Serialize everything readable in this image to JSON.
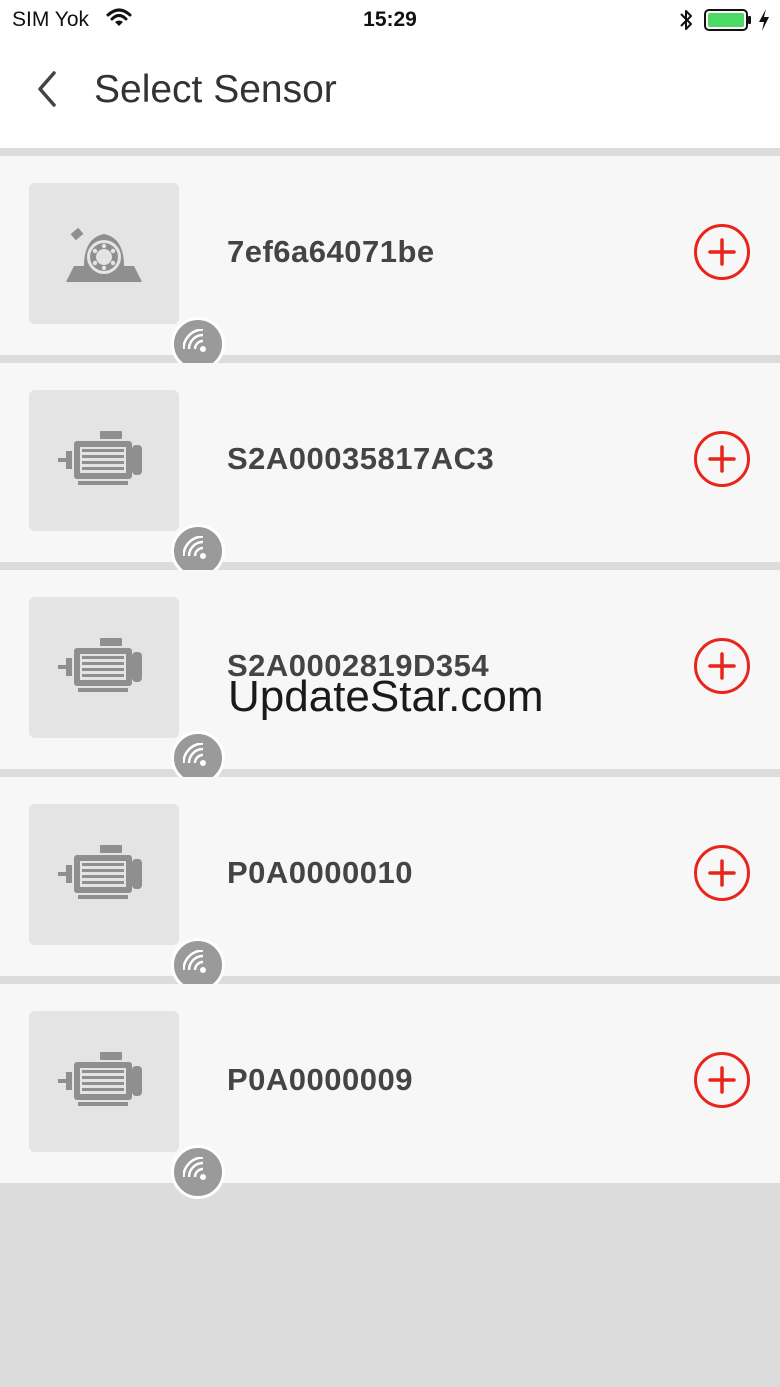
{
  "status_bar": {
    "carrier": "SIM Yok",
    "time": "15:29",
    "battery_color": "#4cd964"
  },
  "nav": {
    "title": "Select Sensor"
  },
  "sensors": [
    {
      "id": "7ef6a64071be",
      "machine_icon": "bearing-icon"
    },
    {
      "id": "S2A00035817AC3",
      "machine_icon": "motor-icon"
    },
    {
      "id": "S2A0002819D354",
      "machine_icon": "motor-icon"
    },
    {
      "id": "P0A0000010",
      "machine_icon": "motor-icon"
    },
    {
      "id": "P0A0000009",
      "machine_icon": "motor-icon"
    }
  ],
  "watermark": "UpdateStar.com",
  "colors": {
    "accent": "#e8241b",
    "row_bg": "#f7f7f7",
    "page_bg": "#dcdcdc",
    "badge": "#9a9a9a"
  }
}
